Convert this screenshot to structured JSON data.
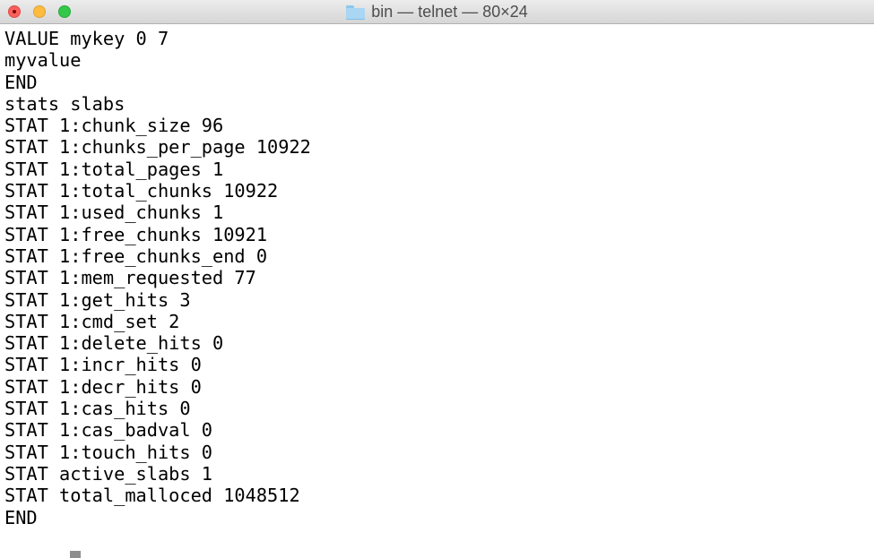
{
  "window": {
    "title": "bin — telnet — 80×24",
    "title_icon": "folder-icon",
    "controls": [
      "close",
      "minimize",
      "zoom"
    ]
  },
  "terminal": {
    "lines": [
      "VALUE mykey 0 7",
      "myvalue",
      "END",
      "stats slabs",
      "STAT 1:chunk_size 96",
      "STAT 1:chunks_per_page 10922",
      "STAT 1:total_pages 1",
      "STAT 1:total_chunks 10922",
      "STAT 1:used_chunks 1",
      "STAT 1:free_chunks 10921",
      "STAT 1:free_chunks_end 0",
      "STAT 1:mem_requested 77",
      "STAT 1:get_hits 3",
      "STAT 1:cmd_set 2",
      "STAT 1:delete_hits 0",
      "STAT 1:incr_hits 0",
      "STAT 1:decr_hits 0",
      "STAT 1:cas_hits 0",
      "STAT 1:cas_badval 0",
      "STAT 1:touch_hits 0",
      "STAT active_slabs 1",
      "STAT total_malloced 1048512",
      "END"
    ]
  },
  "colors": {
    "background": "#ffffff",
    "text": "#000000",
    "cursor": "#8e8e8e",
    "close": "#fc605c",
    "minimize": "#fdbc40",
    "zoom": "#34c84a"
  }
}
